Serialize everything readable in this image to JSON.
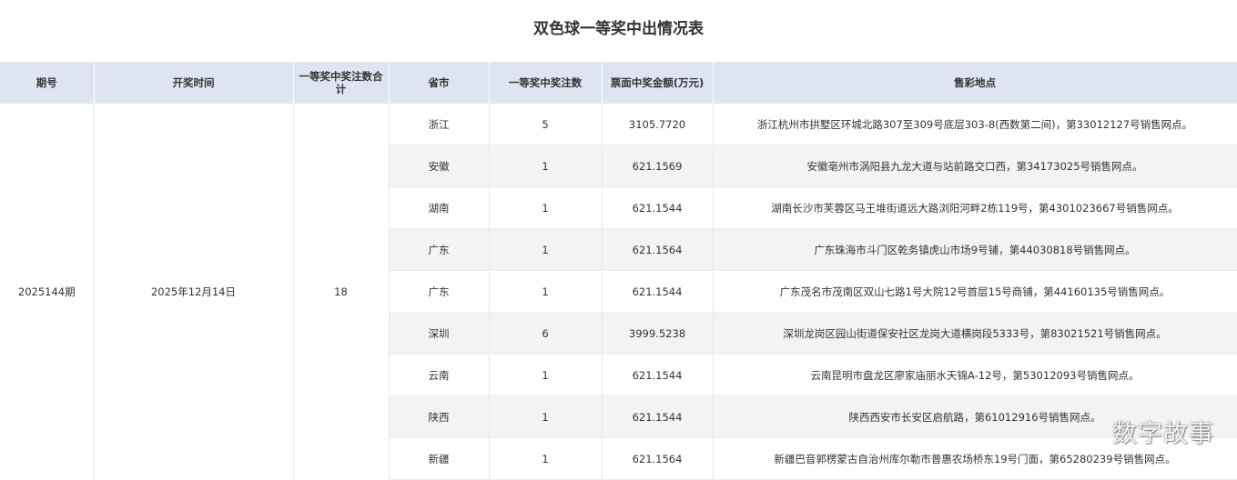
{
  "title": "双色球一等奖中出情况表",
  "table": {
    "headers": {
      "issue": "期号",
      "draw_date": "开奖时间",
      "total_winners": "一等奖中奖注数合计",
      "province": "省市",
      "winners": "一等奖中奖注数",
      "amount": "票面中奖金额(万元)",
      "location": "售彩地点"
    },
    "issue": "2025144期",
    "draw_date": "2025年12月14日",
    "total_winners": "18",
    "rows": [
      {
        "province": "浙江",
        "winners": "5",
        "amount": "3105.7720",
        "location": "浙江杭州市拱墅区环城北路307至309号底层303-8(西数第二间)，第33012127号销售网点。"
      },
      {
        "province": "安徽",
        "winners": "1",
        "amount": "621.1569",
        "location": "安徽亳州市涡阳县九龙大道与站前路交口西，第34173025号销售网点。"
      },
      {
        "province": "湖南",
        "winners": "1",
        "amount": "621.1544",
        "location": "湖南长沙市芙蓉区马王堆街道远大路浏阳河畔2栋119号，第4301023667号销售网点。"
      },
      {
        "province": "广东",
        "winners": "1",
        "amount": "621.1564",
        "location": "广东珠海市斗门区乾务镇虎山市场9号铺，第44030818号销售网点。"
      },
      {
        "province": "广东",
        "winners": "1",
        "amount": "621.1544",
        "location": "广东茂名市茂南区双山七路1号大院12号首层15号商铺，第44160135号销售网点。"
      },
      {
        "province": "深圳",
        "winners": "6",
        "amount": "3999.5238",
        "location": "深圳龙岗区园山街道保安社区龙岗大道横岗段5333号，第83021521号销售网点。"
      },
      {
        "province": "云南",
        "winners": "1",
        "amount": "621.1544",
        "location": "云南昆明市盘龙区廖家庙丽水天锦A-12号，第53012093号销售网点。"
      },
      {
        "province": "陕西",
        "winners": "1",
        "amount": "621.1544",
        "location": "陕西西安市长安区启航路，第61012916号销售网点。"
      },
      {
        "province": "新疆",
        "winners": "1",
        "amount": "621.1564",
        "location": "新疆巴音郭楞蒙古自治州库尔勒市普惠农场桥东19号门面，第65280239号销售网点。"
      }
    ]
  },
  "watermark": "数字故事"
}
